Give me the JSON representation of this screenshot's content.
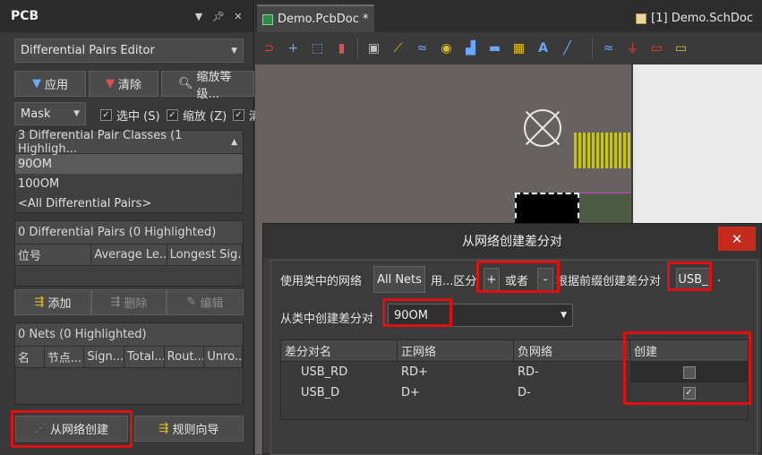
{
  "panel": {
    "title": "PCB",
    "mode_dropdown": "Differential Pairs Editor",
    "buttons": {
      "apply": "应用",
      "clear": "清除",
      "zoom": "缩放等级..."
    },
    "mask_dropdown": "Mask",
    "checks": {
      "select": "选中 (S)",
      "zoom": "缩放 (Z)",
      "clip": "清"
    },
    "classes_header": "3 Differential Pair Classes (1 Highligh...",
    "classes": [
      "90OM",
      "100OM",
      "<All Differential Pairs>"
    ],
    "pairs_header": "0 Differential Pairs (0 Highlighted)",
    "pairs_columns": [
      "位号",
      "Average Le...",
      "Longest Sig..."
    ],
    "pair_buttons": {
      "add": "添加",
      "delete": "删除",
      "edit": "编辑"
    },
    "nets_header": "0 Nets (0 Highlighted)",
    "nets_columns": [
      "名",
      "节点...",
      "Sign...",
      "Total...",
      "Rout...",
      "Unro..."
    ],
    "bottom_buttons": {
      "from_net": "从网络创建",
      "rule_wizard": "规则向导"
    }
  },
  "tabs": {
    "pcb": "Demo.PcbDoc *",
    "sch": "[1] Demo.SchDoc"
  },
  "dialog": {
    "title": "从网络创建差分对",
    "close": "✕",
    "row1_prefix": "使用类中的网络",
    "nets_button": "All Nets",
    "row1_mid": "用...区分",
    "plus": "+",
    "or": "或者",
    "minus": "-",
    "row1_suffix": "根据前缀创建差分对",
    "prefix_value": "USB_",
    "row1_end": ".",
    "row2_label": "从类中创建差分对",
    "class_value": "90OM",
    "table": {
      "columns": [
        "差分对名",
        "正网络",
        "负网络",
        "创建"
      ],
      "rows": [
        {
          "name": "USB_RD",
          "pos": "RD+",
          "neg": "RD-",
          "create": ""
        },
        {
          "name": "USB_D",
          "pos": "D+",
          "neg": "D-",
          "create": "✓"
        }
      ]
    }
  },
  "colors": {
    "accent": "#6aa8ff",
    "highlight_box": "#e01010",
    "close_red": "#c42b1c"
  }
}
